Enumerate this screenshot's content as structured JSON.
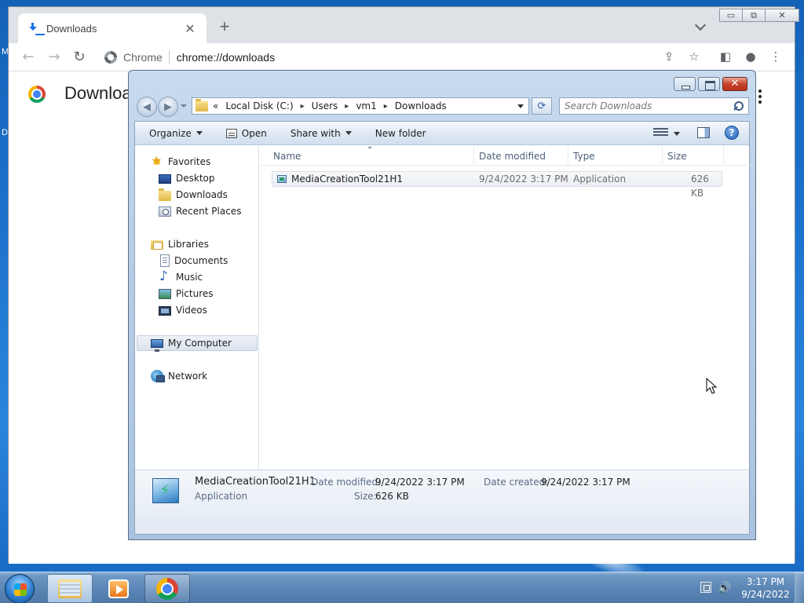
{
  "desktop": {
    "edge_letters": [
      "M",
      "D"
    ]
  },
  "chrome": {
    "tab_title": "Downloads",
    "tab_close": "✕",
    "new_tab": "+",
    "window_controls": {
      "minimize": "▭",
      "maximize": "⧉",
      "close": "✕"
    },
    "nav": {
      "back": "←",
      "forward": "→",
      "reload": "↻"
    },
    "chip": "Chrome",
    "url": "chrome://downloads",
    "toolbar_icons": {
      "share": "⇪",
      "bookmark": "☆",
      "side_panel": "◧",
      "profile": "●",
      "menu": "⋮"
    },
    "page_title": "Downloads"
  },
  "explorer": {
    "caption": {
      "close": "✕"
    },
    "nav": {
      "back": "◀",
      "forward": "▶"
    },
    "breadcrumb": {
      "overflow": "«",
      "items": [
        "Local Disk (C:)",
        "Users",
        "vm1",
        "Downloads"
      ],
      "separator": "▸"
    },
    "refresh": "⟳",
    "search_placeholder": "Search Downloads",
    "commands": {
      "organize": "Organize",
      "open": "Open",
      "share_with": "Share with",
      "new_folder": "New folder",
      "help": "?"
    },
    "nav_pane": {
      "favorites": "Favorites",
      "desktop": "Desktop",
      "downloads": "Downloads",
      "recent_places": "Recent Places",
      "libraries": "Libraries",
      "documents": "Documents",
      "music": "Music",
      "pictures": "Pictures",
      "videos": "Videos",
      "my_computer": "My Computer",
      "network": "Network"
    },
    "columns": {
      "name": "Name",
      "date_modified": "Date modified",
      "type": "Type",
      "size": "Size"
    },
    "files": [
      {
        "name": "MediaCreationTool21H1",
        "date_modified": "9/24/2022 3:17 PM",
        "type": "Application",
        "size": "626 KB"
      }
    ],
    "details": {
      "name": "MediaCreationTool21H1",
      "kind": "Application",
      "date_modified_label": "Date modified:",
      "date_modified": "9/24/2022 3:17 PM",
      "date_created_label": "Date created:",
      "date_created": "9/24/2022 3:17 PM",
      "size_label": "Size:",
      "size": "626 KB"
    }
  },
  "taskbar": {
    "clock_time": "3:17 PM",
    "clock_date": "9/24/2022",
    "volume_icon": "🔊"
  }
}
